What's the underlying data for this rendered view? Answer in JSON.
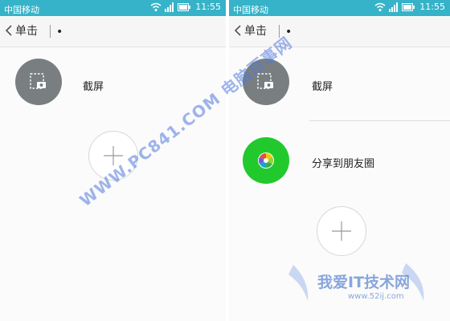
{
  "status_bar": {
    "carrier": "中国移动",
    "time": "11:55"
  },
  "navbar": {
    "back_label": "单击",
    "dot": "•"
  },
  "left_panel": {
    "items": [
      {
        "label": "截屏",
        "icon": "screenshot-icon"
      }
    ],
    "add_icon": "plus-icon"
  },
  "right_panel": {
    "items": [
      {
        "label": "截屏",
        "icon": "screenshot-icon"
      },
      {
        "label": "分享到朋友圈",
        "icon": "moments-icon"
      }
    ],
    "add_icon": "plus-icon"
  },
  "watermark": {
    "text": "WWW.PC841.COM 电脑百事网"
  },
  "logo_watermark": {
    "title": "我爱IT技术网",
    "url": "www.52ij.com"
  },
  "colors": {
    "status_bar": "#36b3c8",
    "gray_circle": "#797e80",
    "green_circle": "#22c92d"
  }
}
